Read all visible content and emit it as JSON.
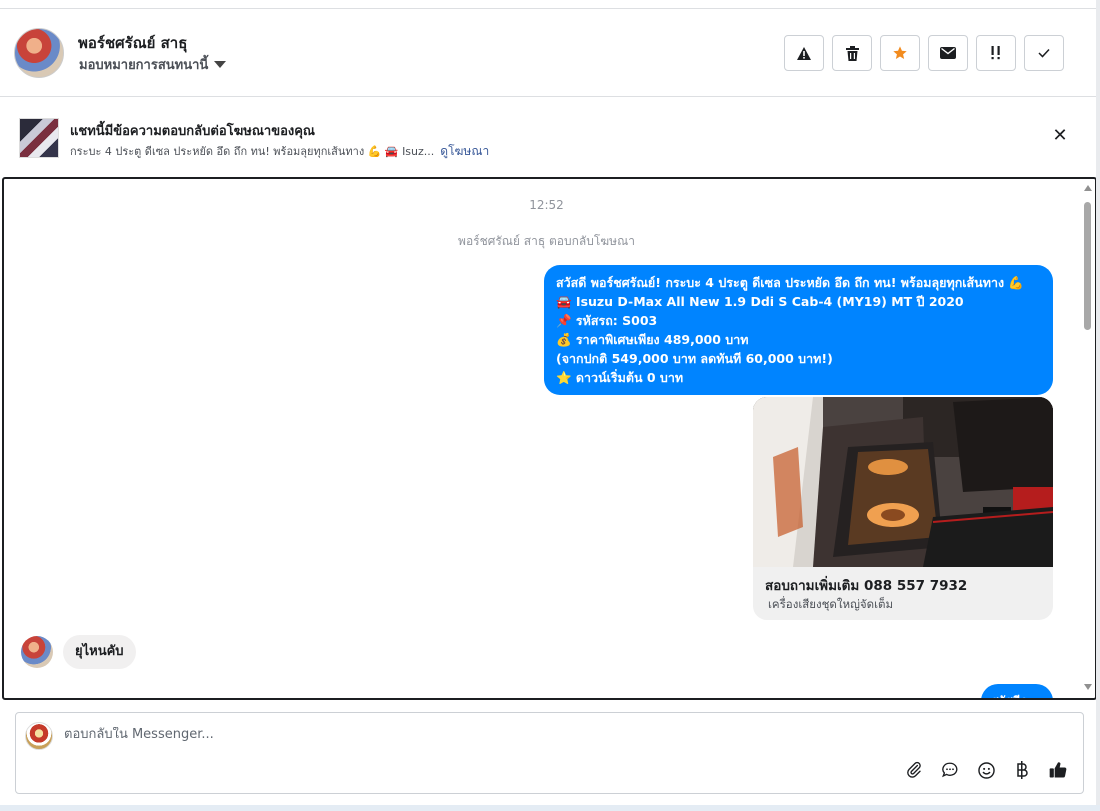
{
  "header": {
    "name": "พอร์ชศรัณย์ สาธุ",
    "assign_label": "มอบหมายการสนทนานี้",
    "actions": [
      {
        "icon": "warning-icon",
        "glyph": "!"
      },
      {
        "icon": "trash-icon",
        "glyph": "🗑"
      },
      {
        "icon": "star-icon",
        "glyph": "★"
      },
      {
        "icon": "envelope-icon",
        "glyph": "✉"
      },
      {
        "icon": "follow-up-icon",
        "glyph": "!!"
      },
      {
        "icon": "check-icon",
        "glyph": "✓"
      }
    ],
    "star_color": "#f28b1e"
  },
  "ad": {
    "title": "แชทนี้มีข้อความตอบกลับต่อโฆษณาของคุณ",
    "subtitle": "กระบะ 4 ประตู ดีเซล ประหยัด อึด ถึก ทน! พร้อมลุยทุกเส้นทาง 💪 🚘 Isuz...",
    "link": "ดูโฆษณา"
  },
  "chat": {
    "time": "12:52",
    "replied_notice": "พอร์ชศรัณย์ สาธุ ตอบกลับโฆษณา",
    "outgoing_lines": [
      "สวัสดี พอร์ชศรัณย์! กระบะ 4 ประตู ดีเซล ประหยัด อึด ถึก ทน! พร้อมลุยทุกเส้นทาง 💪",
      "🚘 Isuzu D-Max All New 1.9 Ddi S Cab-4 (MY19) MT ปี 2020",
      "📌 รหัสรถ: S003",
      "💰 ราคาพิเศษเพียง 489,000 บาท",
      "(จากปกติ 549,000 บาท ลดทันที 60,000 บาท!)",
      "⭐ ดาวน์เริ่มต้น 0 บาท"
    ],
    "card": {
      "title": "สอบถามเพิ่มเติม 088 557 7932",
      "subtitle": "เครื่องเสียงชุดใหญ่จัดเต็ม"
    },
    "incoming": "ยุไหนคับ",
    "peek": "สวัสดีค"
  },
  "composer": {
    "placeholder": "ตอบกลับใน Messenger...",
    "tools": [
      "paperclip-icon",
      "chat-bubble-icon",
      "smiley-icon",
      "baht-icon",
      "thumbs-up-icon"
    ]
  },
  "colors": {
    "accent": "#0084ff",
    "link": "#385898"
  }
}
